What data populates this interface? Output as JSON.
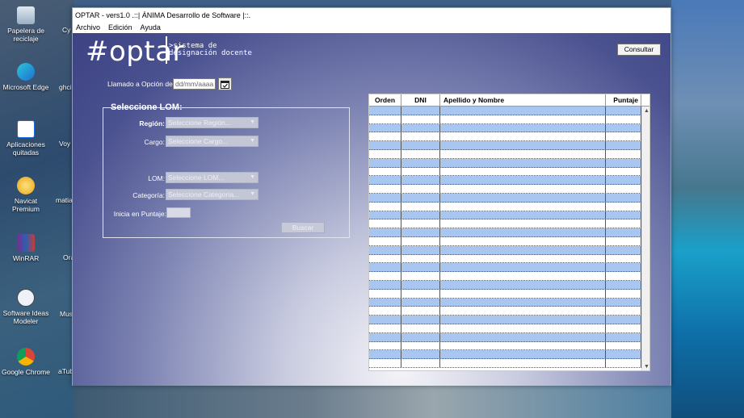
{
  "window": {
    "title": "OPTAR - vers1.0 .::| ÁNIMA Desarrollo de Software |::."
  },
  "menu": {
    "items": [
      "Archivo",
      "Edición",
      "Ayuda"
    ]
  },
  "header": {
    "logo": "#optar",
    "tagline_line1": ">sistema de",
    "tagline_line2": "designación docente",
    "consultar_label": "Consultar"
  },
  "llamado": {
    "label": "Llamado a Opción del:",
    "date_placeholder": "dd/mm/aaaa"
  },
  "lom_form": {
    "title": "Seleccione LOM:",
    "region_label": "Región:",
    "region_value": "Seleccione Región...",
    "cargo_label": "Cargo:",
    "cargo_value": "Seleccione Cargo...",
    "lom_label": "LOM:",
    "lom_value": "Seleccione LOM...",
    "categoria_label": "Categoría:",
    "categoria_value": "Seleccione Categoría...",
    "puntaje_label": "Inicia en Puntaje:",
    "buscar_label": "Buscar"
  },
  "grid": {
    "columns": [
      "Orden",
      "DNI",
      "Apellido y Nombre",
      "Puntaje"
    ],
    "row_count": 30,
    "alt_color": "#a8c6f0"
  },
  "desktop": {
    "icons": [
      {
        "label": "Papelera de reciclaje",
        "icon": "recycle-bin-icon"
      },
      {
        "label": "Microsoft Edge",
        "icon": "edge-icon"
      },
      {
        "label": "Aplicaciones quitadas",
        "icon": "html-file-icon"
      },
      {
        "label": "Navicat Premium",
        "icon": "navicat-icon"
      },
      {
        "label": "WinRAR",
        "icon": "winrar-icon"
      },
      {
        "label": "Software Ideas Modeler",
        "icon": "modeler-icon"
      },
      {
        "label": "Google Chrome",
        "icon": "chrome-icon"
      }
    ],
    "partial_labels": [
      "Cy Te",
      "ghci",
      "Voy a",
      "matia d",
      "Ora Vir",
      "Mus",
      "aTub"
    ]
  }
}
